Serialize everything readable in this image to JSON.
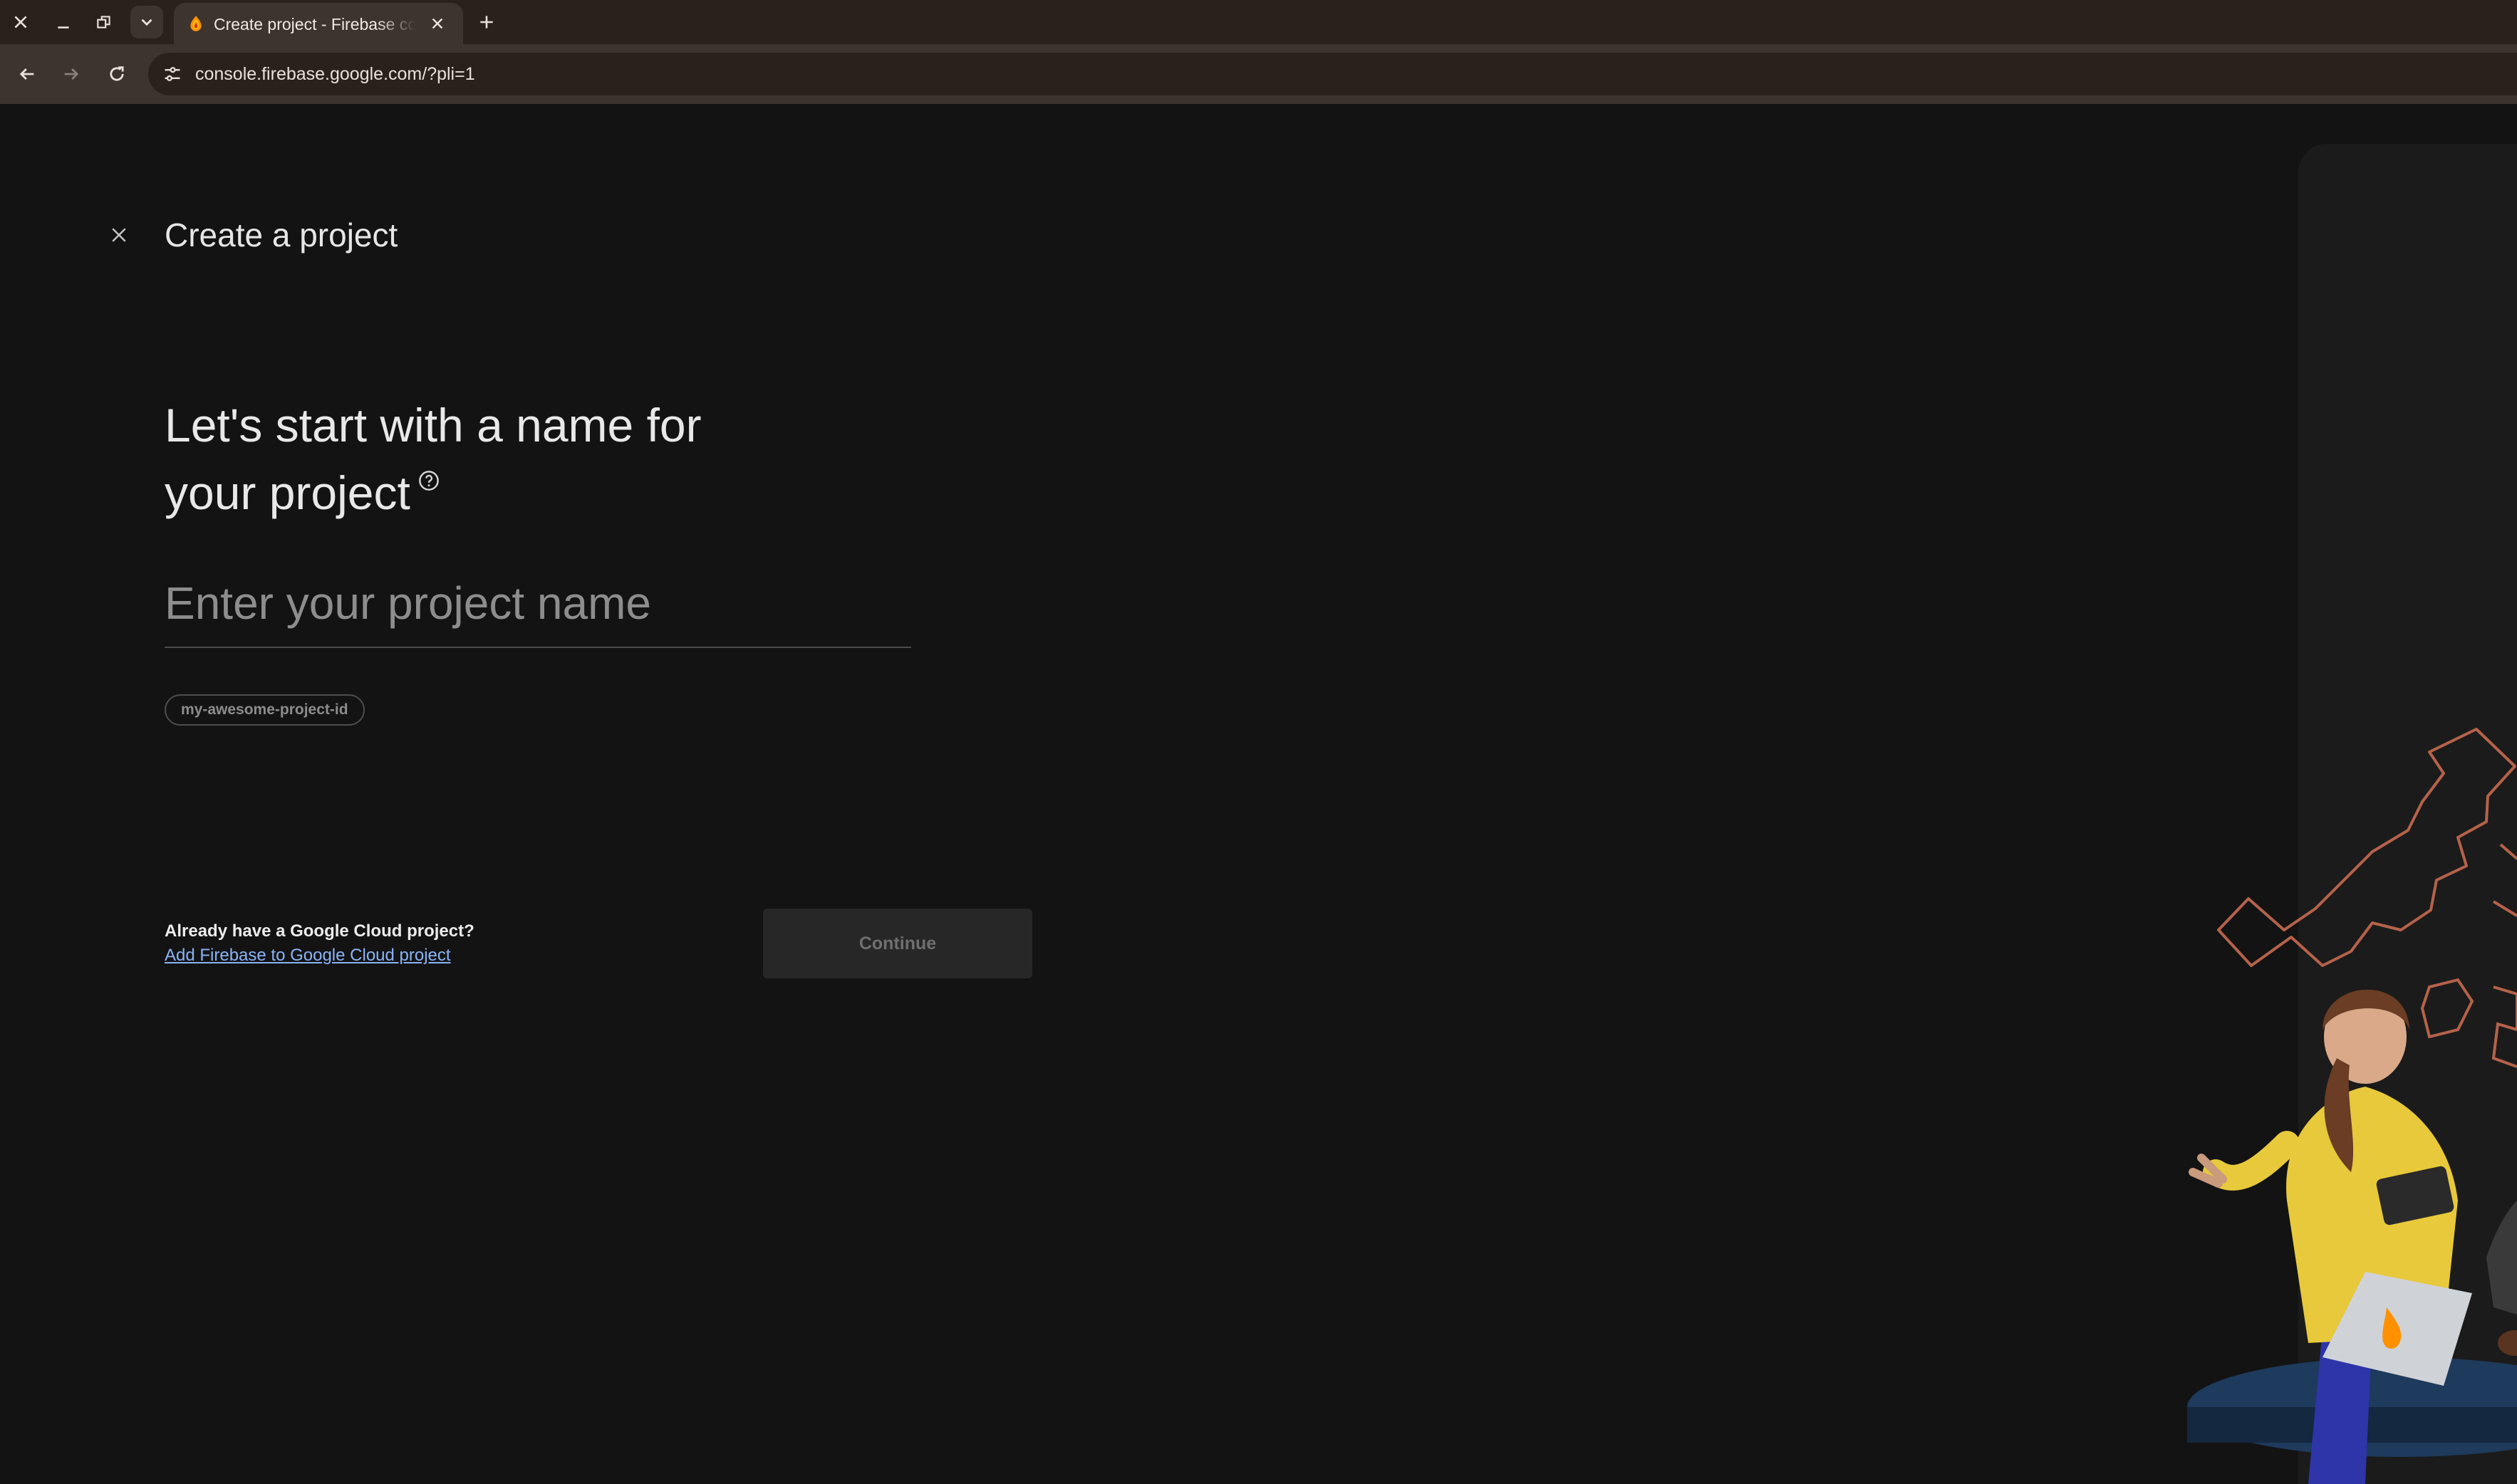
{
  "browser": {
    "tab": {
      "title": "Create project - Firebase console"
    },
    "address_bar": {
      "url": "console.firebase.google.com/?pli=1"
    }
  },
  "page": {
    "title": "Create a project",
    "heading_line1": "Let's start with a name for",
    "heading_line2": "your project",
    "name_input": {
      "placeholder": "Enter your project name",
      "value": ""
    },
    "project_id_chip": "my-awesome-project-id",
    "already_have_text": "Already have a Google Cloud project?",
    "gcp_link": "Add Firebase to Google Cloud project",
    "continue_label": "Continue"
  },
  "colors": {
    "background": "#131313",
    "link": "#8ab4f8",
    "tabbar": "#2a211d",
    "toolbar": "#3d3430",
    "art_stroke": "#b5624a"
  },
  "icons": {
    "window_close": "close-icon",
    "minimize": "minimize-icon",
    "restore": "restore-icon",
    "tab_search": "chevron-down-icon",
    "new_tab": "plus-icon",
    "back": "arrow-left-icon",
    "forward": "arrow-right-icon",
    "reload": "reload-icon",
    "site_info": "tune-icon",
    "dialog_close": "close-icon",
    "help": "help-circle-icon"
  }
}
